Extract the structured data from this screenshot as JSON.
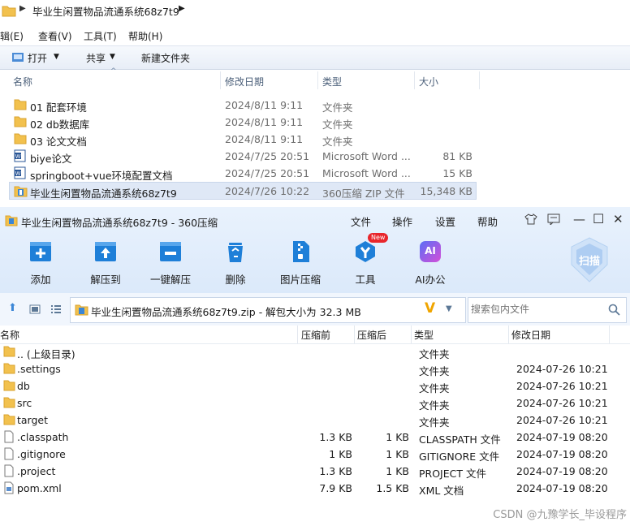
{
  "explorer": {
    "path": "毕业生闲置物品流通系统68z7t9",
    "menu": [
      "辑(E)",
      "查看(V)",
      "工具(T)",
      "帮助(H)"
    ],
    "toolbar": {
      "open": "打开",
      "share": "共享",
      "new_folder": "新建文件夹"
    },
    "columns": {
      "name": "名称",
      "date": "修改日期",
      "type": "类型",
      "size": "大小"
    },
    "rows": [
      {
        "icon": "folder-icon",
        "name": "01 配套环境",
        "date": "2024/8/11 9:11",
        "type": "文件夹",
        "size": ""
      },
      {
        "icon": "folder-icon",
        "name": "02 db数据库",
        "date": "2024/8/11 9:11",
        "type": "文件夹",
        "size": ""
      },
      {
        "icon": "folder-icon",
        "name": "03 论文文档",
        "date": "2024/8/11 9:11",
        "type": "文件夹",
        "size": ""
      },
      {
        "icon": "word-doc-icon",
        "name": "biye论文",
        "date": "2024/7/25 20:51",
        "type": "Microsoft Word ...",
        "size": "81 KB"
      },
      {
        "icon": "word-doc-icon",
        "name": "springboot+vue环境配置文档",
        "date": "2024/7/25 20:51",
        "type": "Microsoft Word ...",
        "size": "15 KB"
      },
      {
        "icon": "zip-icon",
        "name": "毕业生闲置物品流通系统68z7t9",
        "date": "2024/7/26 10:22",
        "type": "360压缩 ZIP 文件",
        "size": "15,348 KB",
        "selected": true
      }
    ]
  },
  "zip": {
    "title": "毕业生闲置物品流通系统68z7t9 - 360压缩",
    "menu": [
      "文件",
      "操作",
      "设置",
      "帮助"
    ],
    "buttons": {
      "add": "添加",
      "extract_to": "解压到",
      "one_click": "一键解压",
      "delete": "删除",
      "image_compress": "图片压缩",
      "tools": "工具",
      "ai_office": "AI办公",
      "scan": "扫描",
      "new_badge": "New",
      "ai_glyph": "AI"
    },
    "address": "毕业生闲置物品流通系统68z7t9.zip - 解包大小为 32.3 MB",
    "search_placeholder": "搜索包内文件",
    "columns": {
      "name": "名称",
      "size": "压缩前",
      "csize": "压缩后",
      "type": "类型",
      "mtime": "修改日期"
    },
    "rows": [
      {
        "icon": "folder-icon",
        "name": ".. (上级目录)",
        "size": "",
        "csize": "",
        "type": "文件夹",
        "mtime": ""
      },
      {
        "icon": "folder-icon",
        "name": ".settings",
        "size": "",
        "csize": "",
        "type": "文件夹",
        "mtime": "2024-07-26 10:21"
      },
      {
        "icon": "folder-icon",
        "name": "db",
        "size": "",
        "csize": "",
        "type": "文件夹",
        "mtime": "2024-07-26 10:21"
      },
      {
        "icon": "folder-icon",
        "name": "src",
        "size": "",
        "csize": "",
        "type": "文件夹",
        "mtime": "2024-07-26 10:21"
      },
      {
        "icon": "folder-icon",
        "name": "target",
        "size": "",
        "csize": "",
        "type": "文件夹",
        "mtime": "2024-07-26 10:21"
      },
      {
        "icon": "file-icon",
        "name": ".classpath",
        "size": "1.3 KB",
        "csize": "1 KB",
        "type": "CLASSPATH 文件",
        "mtime": "2024-07-19 08:20"
      },
      {
        "icon": "file-icon",
        "name": ".gitignore",
        "size": "1 KB",
        "csize": "1 KB",
        "type": "GITIGNORE 文件",
        "mtime": "2024-07-19 08:20"
      },
      {
        "icon": "file-icon",
        "name": ".project",
        "size": "1.3 KB",
        "csize": "1 KB",
        "type": "PROJECT 文件",
        "mtime": "2024-07-19 08:20"
      },
      {
        "icon": "xml-file-icon",
        "name": "pom.xml",
        "size": "7.9 KB",
        "csize": "1.5 KB",
        "type": "XML 文档",
        "mtime": "2024-07-19 08:20"
      }
    ]
  },
  "watermark": "CSDN @九豫学长_毕设程序",
  "colors": {
    "accent": "#1e7fd8",
    "selected_row": "#dfe8f6",
    "folder": "#f2c14e"
  }
}
